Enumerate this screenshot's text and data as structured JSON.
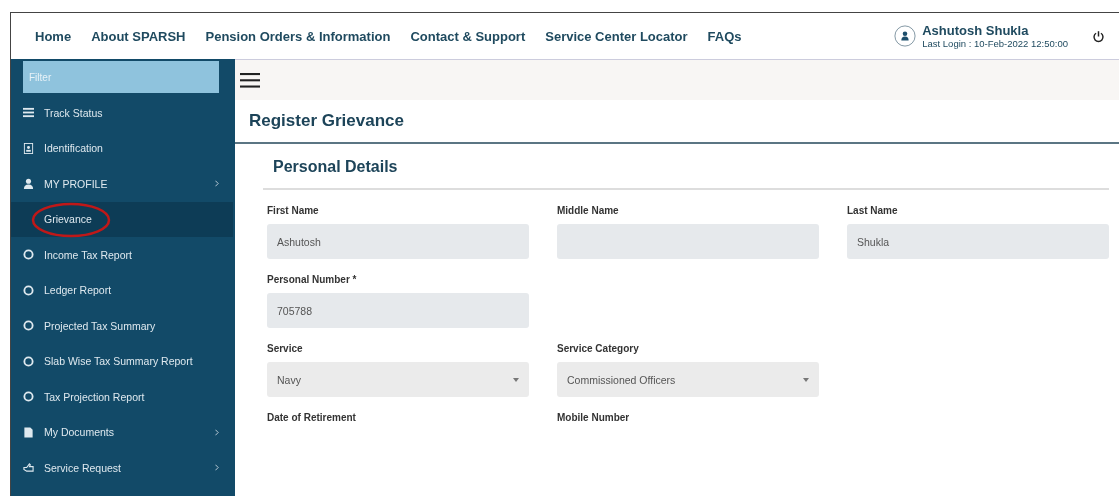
{
  "nav": {
    "links": [
      {
        "label": "Home"
      },
      {
        "label": "About SPARSH"
      },
      {
        "label": "Pension Orders & Information"
      },
      {
        "label": "Contact & Support"
      },
      {
        "label": "Service Center Locator"
      },
      {
        "label": "FAQs"
      }
    ],
    "user": {
      "name": "Ashutosh Shukla",
      "last_login": "Last Login : 10-Feb-2022 12:50:00"
    }
  },
  "sidebar": {
    "filter": {
      "placeholder": "Filter"
    },
    "items": [
      {
        "label": "Track Status",
        "kind": "list",
        "selected": false,
        "submenu": false,
        "circled": false
      },
      {
        "label": "Identification",
        "kind": "id",
        "selected": false,
        "submenu": false,
        "circled": false
      },
      {
        "label": "MY PROFILE",
        "kind": "person",
        "selected": false,
        "submenu": true,
        "circled": false
      },
      {
        "label": "Grievance",
        "kind": "none",
        "selected": true,
        "submenu": false,
        "circled": true
      },
      {
        "label": "Income Tax Report",
        "kind": "circle",
        "selected": false,
        "submenu": false,
        "circled": false
      },
      {
        "label": "Ledger Report",
        "kind": "circle",
        "selected": false,
        "submenu": false,
        "circled": false
      },
      {
        "label": "Projected Tax Summary",
        "kind": "circle",
        "selected": false,
        "submenu": false,
        "circled": false
      },
      {
        "label": "Slab Wise Tax Summary Report",
        "kind": "circle",
        "selected": false,
        "submenu": false,
        "circled": false
      },
      {
        "label": "Tax Projection Report",
        "kind": "circle",
        "selected": false,
        "submenu": false,
        "circled": false
      },
      {
        "label": "My Documents",
        "kind": "document",
        "selected": false,
        "submenu": true,
        "circled": false
      },
      {
        "label": "Service Request",
        "kind": "hand",
        "selected": false,
        "submenu": true,
        "circled": false
      }
    ]
  },
  "page": {
    "title": "Register Grievance",
    "section": "Personal Details",
    "rows": [
      [
        {
          "label": "First Name",
          "kind": "text",
          "value": "Ashutosh"
        },
        {
          "label": "Middle Name",
          "kind": "text"
        },
        {
          "label": "Last Name",
          "kind": "text",
          "value": "Shukla"
        }
      ],
      [
        {
          "label": "Personal Number *",
          "kind": "text",
          "value": "705788"
        }
      ],
      [
        {
          "label": "Service",
          "kind": "select",
          "value": "Navy"
        },
        {
          "label": "Service Category",
          "kind": "select",
          "value": "Commissioned Officers"
        }
      ],
      [
        {
          "label": "Date of Retirement",
          "kind": "label"
        },
        {
          "label": "Mobile Number",
          "kind": "label"
        }
      ]
    ]
  }
}
